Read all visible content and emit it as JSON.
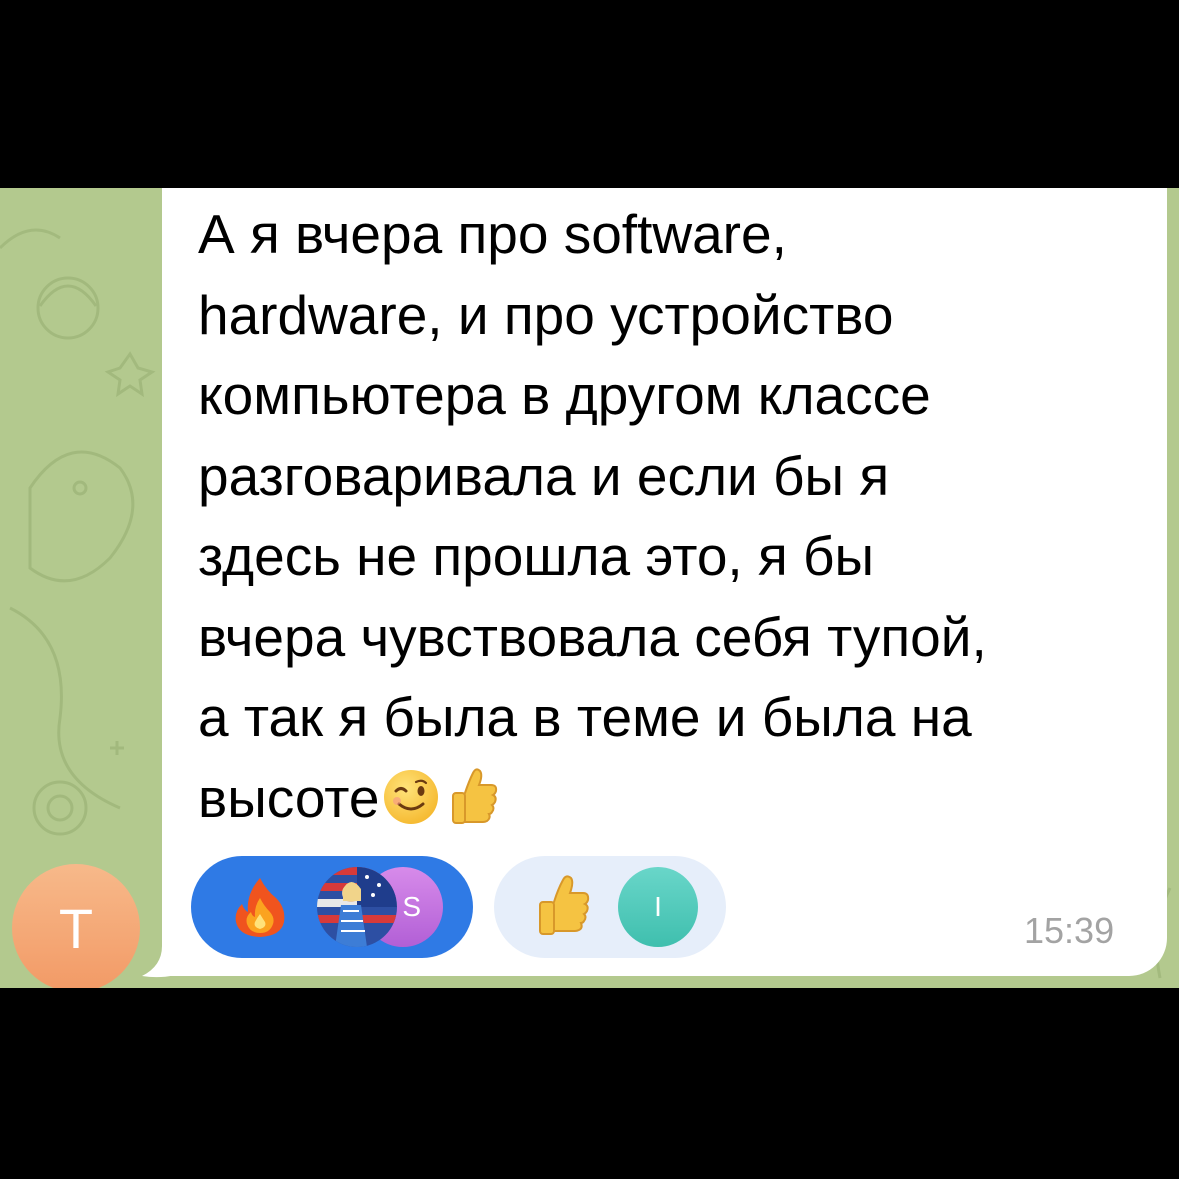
{
  "message": {
    "lines": [
      "А я вчера про software,",
      "hardware, и про устройство",
      "компьютера в другом классе",
      "разговаривала и если бы я",
      "здесь не прошла это, я бы",
      "вчера чувствовала себя тупой,",
      "а так я была в теме и была на",
      "высоте"
    ],
    "trailing_emojis": [
      "winking-face",
      "thumbs-up"
    ],
    "time": "15:39"
  },
  "sender": {
    "avatar_letter": "Т"
  },
  "reactions": [
    {
      "emoji": "fire",
      "selected": true,
      "reactor_avatars": [
        "photo",
        "S"
      ]
    },
    {
      "emoji": "thumbs-up",
      "selected": false,
      "reactor_avatars": [
        "I"
      ]
    }
  ],
  "colors": {
    "chat_background": "#b3c98e",
    "bubble": "#ffffff",
    "selected_reaction": "#2f7ae5",
    "reaction": "#e6eefa",
    "timestamp": "#a3a3a3",
    "sender_avatar": "#f29a66"
  }
}
